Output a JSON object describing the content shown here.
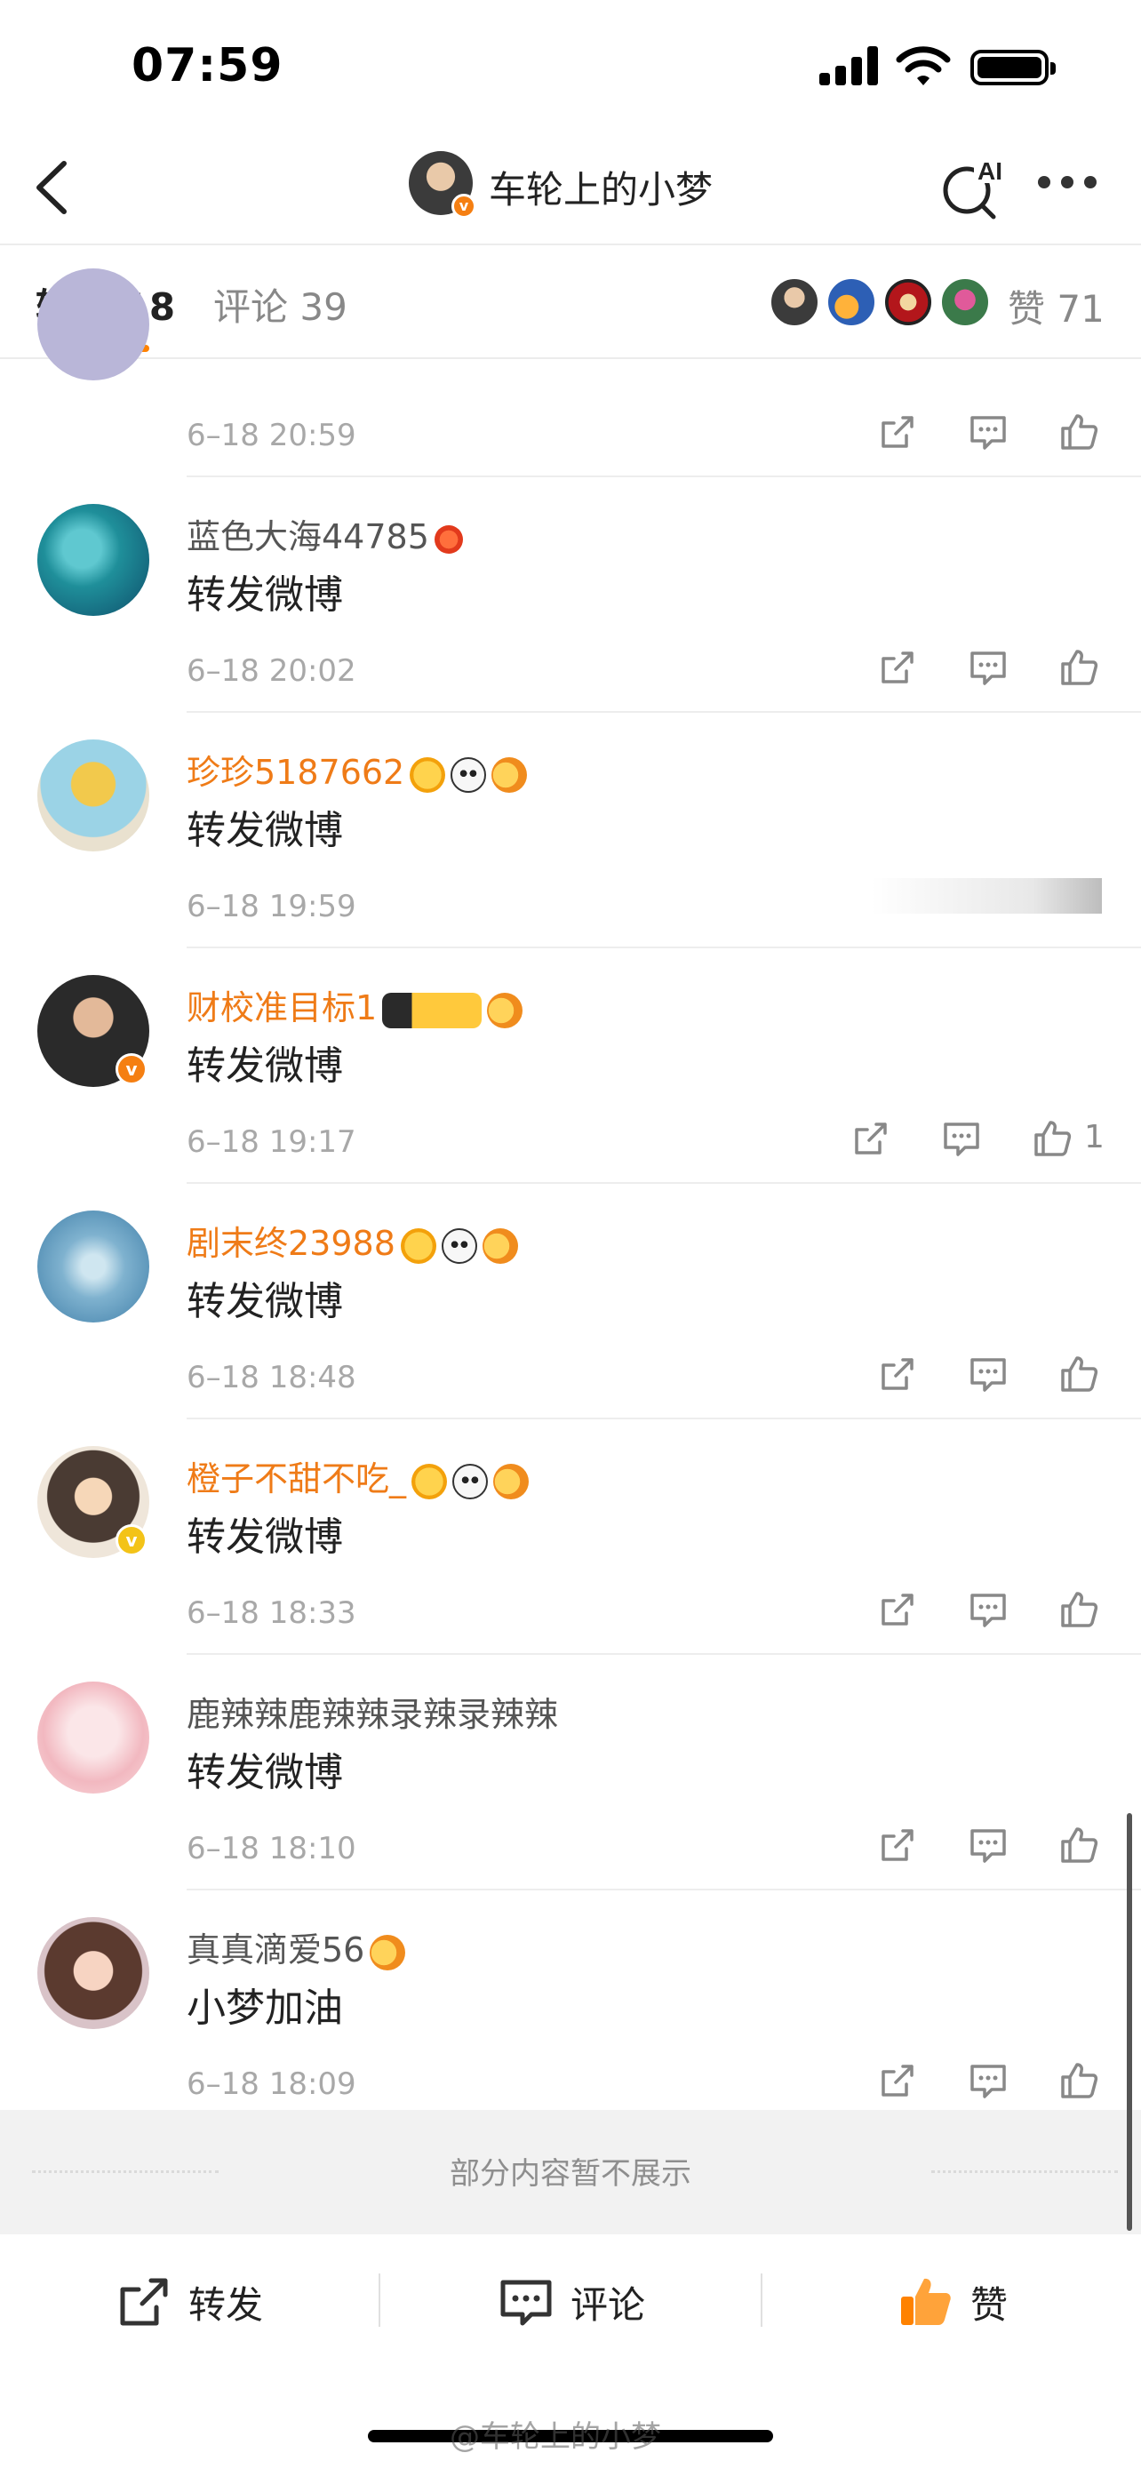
{
  "status_bar": {
    "time": "07:59"
  },
  "nav": {
    "title": "车轮上的小梦",
    "ai_label": "AI"
  },
  "tabs": {
    "repost_label": "转发 18",
    "comment_label": "评论 39",
    "likes_label": "赞 71"
  },
  "rows": [
    {
      "name": "",
      "content": "",
      "date": "6–18 20:59"
    },
    {
      "name": "蓝色大海44785",
      "content": "转发微博",
      "date": "6–18 20:02"
    },
    {
      "name": "珍珍5187662",
      "content": "转发微博",
      "date": "6–18 19:59"
    },
    {
      "name": "财校准目标1",
      "content": "转发微博",
      "date": "6–18 19:17",
      "likes": "1"
    },
    {
      "name": "剧末终23988",
      "content": "转发微博",
      "date": "6–18 18:48"
    },
    {
      "name": "橙子不甜不吃_",
      "content": "转发微博",
      "date": "6–18 18:33"
    },
    {
      "name": "鹿辣辣鹿辣辣录辣录辣辣",
      "content": "转发微博",
      "date": "6–18 18:10"
    },
    {
      "name": "真真滴爱56",
      "content": "小梦加油",
      "date": "6–18 18:09"
    }
  ],
  "notice": {
    "text": "部分内容暂不展示"
  },
  "bottom_bar": {
    "repost": "转发",
    "comment": "评论",
    "like": "赞"
  },
  "watermark": "@车轮上的小梦",
  "colors": {
    "accent": "#ff8200",
    "vip_name": "#ef7b17",
    "date": "#a8a8a8"
  }
}
